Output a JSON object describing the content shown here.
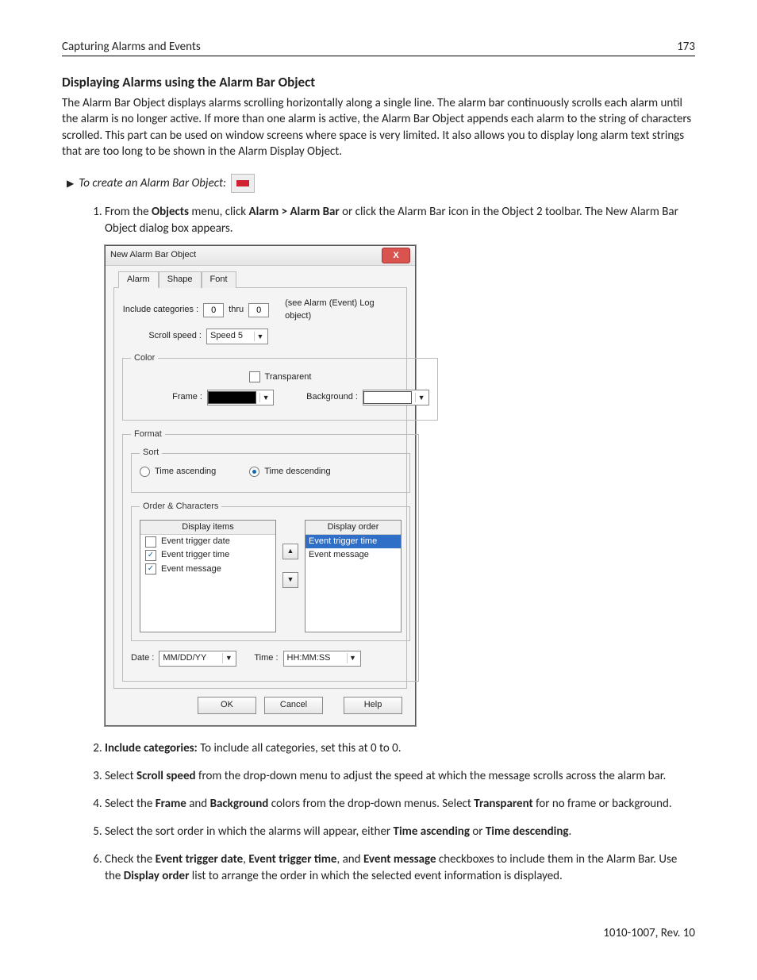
{
  "header": {
    "chapter": "Capturing Alarms and Events",
    "page_no": "173"
  },
  "section_title": "Displaying Alarms using the Alarm Bar Object",
  "intro_para": "The Alarm Bar Object displays alarms scrolling horizontally along a single line. The alarm bar continuously scrolls each alarm until the alarm is no longer active. If more than one alarm is active, the Alarm Bar Object appends each alarm to the string of characters scrolled. This part can be used on window screens where space is very limited. It also allows you to display long alarm text strings that are too long to be shown in the Alarm Display Object.",
  "task_line": "To create an Alarm Bar Object:",
  "step1": {
    "pre": "From the ",
    "b1": "Objects",
    "mid1": " menu, click ",
    "b2": "Alarm > Alarm Bar",
    "mid2": " or click the Alarm Bar icon in the Object 2 toolbar. The New Alarm Bar Object dialog box appears."
  },
  "dialog": {
    "title": "New  Alarm Bar Object",
    "close": "X",
    "tabs": {
      "alarm": "Alarm",
      "shape": "Shape",
      "font": "Font"
    },
    "include_label": "Include categories :",
    "include_from": "0",
    "thru_label": "thru",
    "include_to": "0",
    "include_hint": "(see Alarm (Event) Log object)",
    "scroll_label": "Scroll speed :",
    "scroll_value": "Speed 5",
    "color_legend": "Color",
    "transparent_label": "Transparent",
    "frame_label": "Frame :",
    "background_label": "Background :",
    "format_legend": "Format",
    "sort_legend": "Sort",
    "sort_asc": "Time ascending",
    "sort_desc": "Time descending",
    "order_legend": "Order & Characters",
    "display_items_header": "Display items",
    "display_order_header": "Display order",
    "items": {
      "date": "Event trigger date",
      "time": "Event trigger time",
      "msg": "Event message"
    },
    "date_label": "Date :",
    "date_value": "MM/DD/YY",
    "time_label": "Time :",
    "time_value": "HH:MM:SS",
    "ok": "OK",
    "cancel": "Cancel",
    "help": "Help"
  },
  "step2": {
    "b": "Include categories:",
    "t": " To include all categories, set this at 0 to 0."
  },
  "step3": {
    "pre": "Select ",
    "b": "Scroll speed",
    "post": " from the drop-down menu to adjust the speed at which the message scrolls across the alarm bar."
  },
  "step4": {
    "pre": "Select the ",
    "b1": "Frame",
    "mid1": " and ",
    "b2": "Background",
    "mid2": " colors from the drop-down menus. Select ",
    "b3": "Transparent",
    "post": " for no frame or background."
  },
  "step5": {
    "pre": "Select the sort order in which the alarms will appear, either ",
    "b1": "Time ascending",
    "mid": " or ",
    "b2": "Time descending",
    "post": "."
  },
  "step6": {
    "pre": "Check the ",
    "b1": "Event trigger date",
    "c1": ", ",
    "b2": "Event trigger time",
    "c2": ", and ",
    "b3": "Event message",
    "mid": " checkboxes to include them in the Alarm Bar. Use the ",
    "b4": "Display order",
    "post": " list to arrange the order in which the selected event information is displayed."
  },
  "footer": "1010-1007, Rev. 10"
}
